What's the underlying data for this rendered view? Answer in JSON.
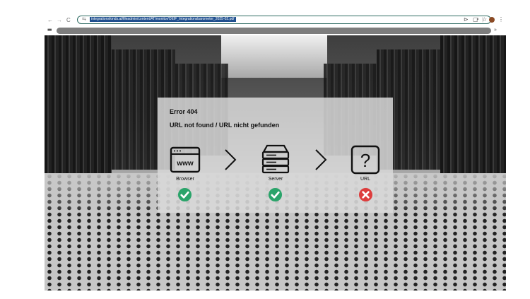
{
  "browser": {
    "back": "←",
    "forward": "→",
    "reload": "C",
    "url": "integrationsfonds.at/fileadmin/content/AT/monitor/OEIF_Integrationsbarometer_2025-02.pdf",
    "more_label": "»"
  },
  "error": {
    "code": "Error 404",
    "message": "URL not found / URL nicht gefunden"
  },
  "steps": [
    {
      "label": "Browser",
      "icon": "browser-window-icon",
      "status": "ok"
    },
    {
      "label": "Server",
      "icon": "server-icon",
      "status": "ok"
    },
    {
      "label": "URL",
      "icon": "question-mark-icon",
      "status": "error"
    }
  ],
  "colors": {
    "ok": "#2aa46a",
    "error": "#dd3d3d",
    "url_highlight": "#1f4f8f"
  }
}
